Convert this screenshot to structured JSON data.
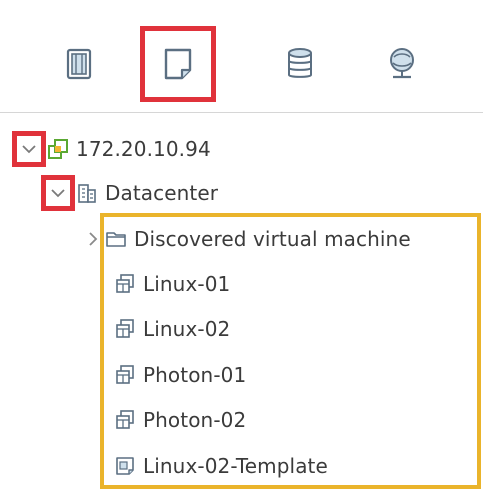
{
  "tabs": [
    {
      "icon": "hosts-clusters-icon",
      "active": false
    },
    {
      "icon": "vms-templates-icon",
      "active": true
    },
    {
      "icon": "storage-icon",
      "active": false
    },
    {
      "icon": "networking-icon",
      "active": false
    }
  ],
  "tree": {
    "vcenter": {
      "label": "172.20.10.94",
      "icon": "vcenter-icon",
      "expanded": true
    },
    "datacenter": {
      "label": "Datacenter",
      "icon": "datacenter-icon",
      "expanded": true
    },
    "items": [
      {
        "label": "Discovered virtual machine",
        "icon": "folder-icon",
        "expandable": true
      },
      {
        "label": "Linux-01",
        "icon": "vm-icon"
      },
      {
        "label": "Linux-02",
        "icon": "vm-icon"
      },
      {
        "label": "Photon-01",
        "icon": "vm-icon"
      },
      {
        "label": "Photon-02",
        "icon": "vm-icon"
      },
      {
        "label": "Linux-02-Template",
        "icon": "template-icon"
      }
    ]
  },
  "colors": {
    "highlight_red": "#e0323b",
    "highlight_yellow": "#eab42b",
    "icon_stroke": "#5b6f82",
    "vcenter_green": "#5aa832"
  }
}
